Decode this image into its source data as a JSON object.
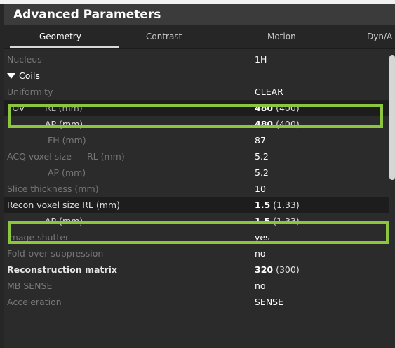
{
  "panel": {
    "title": "Advanced Parameters"
  },
  "tabs": [
    {
      "label": "Geometry",
      "active": true
    },
    {
      "label": "Contrast",
      "active": false
    },
    {
      "label": "Motion",
      "active": false
    },
    {
      "label": "Dyn/A",
      "active": false
    }
  ],
  "params": {
    "nucleus": {
      "label": "Nucleus",
      "value": "1H"
    },
    "coils": {
      "label": "Coils",
      "icon": "triangle-down-icon"
    },
    "uniformity": {
      "label": "Uniformity",
      "value": "CLEAR"
    },
    "fov_rl": {
      "label": "FOV",
      "sublabel": "RL (mm)",
      "value": "480",
      "secondary": "(400)"
    },
    "fov_ap": {
      "label": "AP (mm)",
      "value": "480",
      "secondary": "(400)"
    },
    "fov_fh": {
      "label": "FH (mm)",
      "value": "87"
    },
    "acq_rl": {
      "label": "ACQ voxel size",
      "sublabel": "RL (mm)",
      "value": "5.2"
    },
    "acq_ap": {
      "label": "AP (mm)",
      "value": "5.2"
    },
    "slice_thickness": {
      "label": "Slice thickness (mm)",
      "value": "10"
    },
    "recon_rl": {
      "label": "Recon voxel size RL (mm)",
      "value": "1.5",
      "secondary": "(1.33)"
    },
    "recon_ap": {
      "label": "AP (mm)",
      "value": "1.5",
      "secondary": "(1.33)"
    },
    "image_shutter": {
      "label": "Image shutter",
      "value": "yes"
    },
    "fold_over": {
      "label": "Fold-over suppression",
      "value": "no"
    },
    "recon_matrix": {
      "label": "Reconstruction matrix",
      "value": "320",
      "secondary": "(300)"
    },
    "mb_sense": {
      "label": "MB SENSE",
      "value": "no"
    },
    "acceleration": {
      "label": "Acceleration",
      "value": "SENSE"
    }
  },
  "colors": {
    "highlight": "#8cc63f",
    "panel": "#2b2b2b",
    "titlebar": "#3b3b3b"
  }
}
